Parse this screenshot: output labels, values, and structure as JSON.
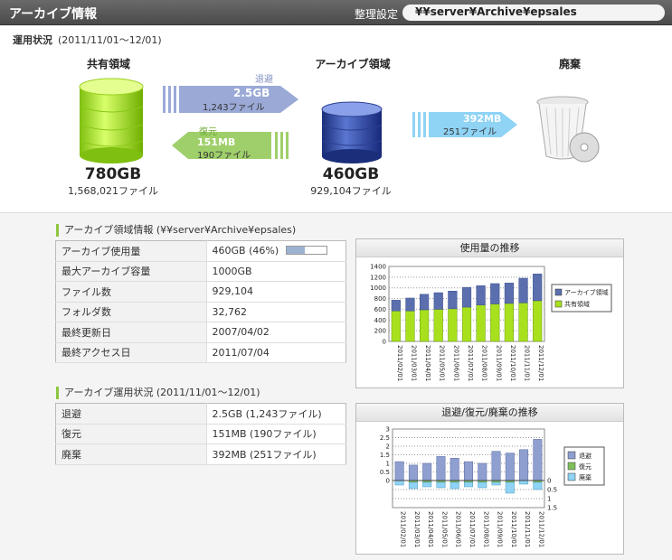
{
  "header": {
    "title": "アーカイブ情報",
    "settings_label": "整理設定",
    "path": "¥¥server¥Archive¥epsales"
  },
  "overview": {
    "status_label": "運用状況",
    "period": "(2011/11/01～12/01)",
    "shared": {
      "title": "共有領域",
      "size": "780GB",
      "files": "1,568,021ファイル"
    },
    "archive": {
      "title": "アーカイブ領域",
      "size": "460GB",
      "files": "929,104ファイル"
    },
    "disposal": {
      "title": "廃棄"
    },
    "evacuate": {
      "label": "退避",
      "size": "2.5GB",
      "files": "1,243ファイル"
    },
    "restore": {
      "label": "復元",
      "size": "151MB",
      "files": "190ファイル"
    },
    "discard": {
      "size": "392MB",
      "files": "251ファイル"
    }
  },
  "archive_info": {
    "title": "アーカイブ領域情報 (¥¥server¥Archive¥epsales)",
    "usage_fraction": 0.46,
    "rows": [
      {
        "key": "アーカイブ使用量",
        "value": "460GB (46%)"
      },
      {
        "key": "最大アーカイブ容量",
        "value": "1000GB"
      },
      {
        "key": "ファイル数",
        "value": "929,104"
      },
      {
        "key": "フォルダ数",
        "value": "32,762"
      },
      {
        "key": "最終更新日",
        "value": "2007/04/02"
      },
      {
        "key": "最終アクセス日",
        "value": "2011/07/04"
      }
    ]
  },
  "ops_info": {
    "title": "アーカイブ運用状況 (2011/11/01～12/01)",
    "rows": [
      {
        "key": "退避",
        "value": "2.5GB (1,243ファイル)"
      },
      {
        "key": "復元",
        "value": "151MB (190ファイル)"
      },
      {
        "key": "廃棄",
        "value": "392MB (251ファイル)"
      }
    ]
  },
  "colors": {
    "archive": "#5b6fae",
    "shared": "#a8e01e",
    "evacuate": "#8e9fd0",
    "restore": "#7fbf5a",
    "discard": "#8fd3f5",
    "accent": "#8cc63f"
  },
  "chart_data": [
    {
      "type": "bar",
      "title": "使用量の推移",
      "categories": [
        "2011/02/01",
        "2011/03/01",
        "2011/04/01",
        "2011/05/01",
        "2011/06/01",
        "2011/07/01",
        "2011/08/01",
        "2011/09/01",
        "2011/10/01",
        "2011/11/01",
        "2011/12/01"
      ],
      "stacked": true,
      "ylim": [
        0,
        1400
      ],
      "yticks": [
        0,
        200,
        400,
        600,
        800,
        1000,
        1200,
        1400
      ],
      "legend": "right",
      "grid": true,
      "series": [
        {
          "name": "共有領域",
          "values": [
            570,
            570,
            590,
            600,
            610,
            640,
            680,
            700,
            710,
            720,
            760
          ]
        },
        {
          "name": "アーカイブ領域",
          "values": [
            200,
            240,
            290,
            310,
            330,
            370,
            360,
            380,
            380,
            460,
            500
          ]
        }
      ]
    },
    {
      "type": "bar",
      "title": "退避/復元/廃棄の推移",
      "categories": [
        "2011/02/01",
        "2011/03/01",
        "2011/04/01",
        "2011/05/01",
        "2011/06/01",
        "2011/07/01",
        "2011/08/01",
        "2011/09/01",
        "2011/10/01",
        "2011/11/01",
        "2011/12/01"
      ],
      "ylim_top": [
        0,
        3
      ],
      "yticks_top": [
        0,
        0.5,
        1,
        1.5,
        2,
        2.5,
        3
      ],
      "ylim_bottom": [
        0,
        1.5
      ],
      "yticks_bottom": [
        0,
        0.5,
        1,
        1.5
      ],
      "legend": "right",
      "grid": true,
      "series": [
        {
          "name": "退避",
          "values": [
            1.1,
            0.9,
            1.0,
            1.4,
            1.3,
            1.1,
            1.0,
            1.7,
            1.6,
            1.8,
            2.4
          ]
        },
        {
          "name": "復元",
          "values": [
            0.0,
            0.1,
            0.1,
            0.1,
            0.1,
            0.1,
            0.1,
            0.1,
            0.1,
            0.0,
            0.1
          ]
        },
        {
          "name": "廃棄",
          "values": [
            0.25,
            0.35,
            0.25,
            0.3,
            0.35,
            0.25,
            0.3,
            0.15,
            0.6,
            0.2,
            0.4
          ]
        }
      ]
    }
  ]
}
